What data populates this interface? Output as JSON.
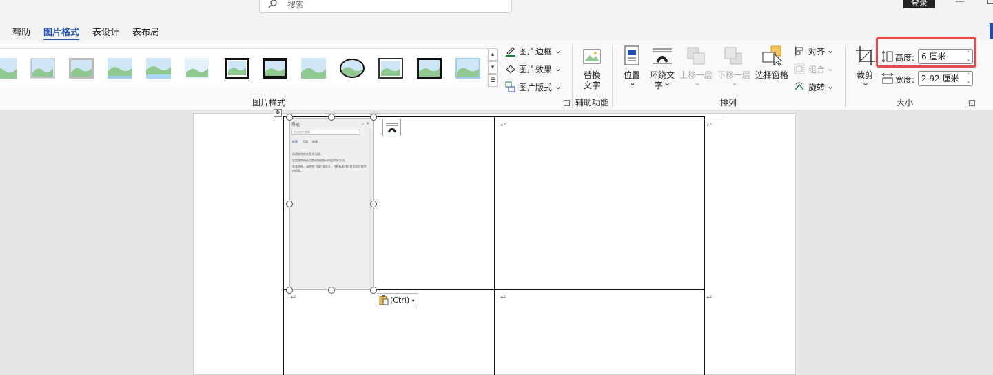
{
  "titlebar": {
    "search_placeholder": "搜索",
    "login_label": "登录"
  },
  "tabs": [
    {
      "label": "帮助"
    },
    {
      "label": "图片格式",
      "active": true
    },
    {
      "label": "表设计"
    },
    {
      "label": "表布局"
    }
  ],
  "picture_styles": {
    "group_label": "图片样式",
    "border_label": "图片边框",
    "effects_label": "图片效果",
    "layout_label": "图片版式"
  },
  "accessibility": {
    "group_label": "辅助功能",
    "alt_text_line1": "替换",
    "alt_text_line2": "文字"
  },
  "arrange": {
    "group_label": "排列",
    "position_label": "位置",
    "wrap_text_line1": "环绕文",
    "wrap_text_line2": "字",
    "bring_forward_label": "上移一层",
    "send_backward_label": "下移一层",
    "selection_pane_label": "选择窗格",
    "align_label": "对齐",
    "group_label_btn": "组合",
    "rotate_label": "旋转"
  },
  "size": {
    "group_label": "大小",
    "crop_label": "裁剪",
    "height_label": "高度:",
    "height_value": "6 厘米",
    "width_label": "宽度:",
    "width_value": "2.92 厘米"
  },
  "document": {
    "paste_options_label": "(Ctrl)",
    "embedded_screenshot": {
      "title": "导航",
      "search_placeholder": "在文档中搜索",
      "tab_headings": "标题",
      "tab_pages": "页面",
      "tab_results": "结果",
      "line1": "创建文档的交互式大纲。",
      "line2": "它是跟踪所处位置或快速移动内容的好方法。",
      "line3": "若要开始，请转到\"开始\"选项卡，并将标题样式应用到文档中的标题。"
    }
  },
  "colors": {
    "accent": "#1f4fb3",
    "highlight_box": "#e84a4a"
  }
}
